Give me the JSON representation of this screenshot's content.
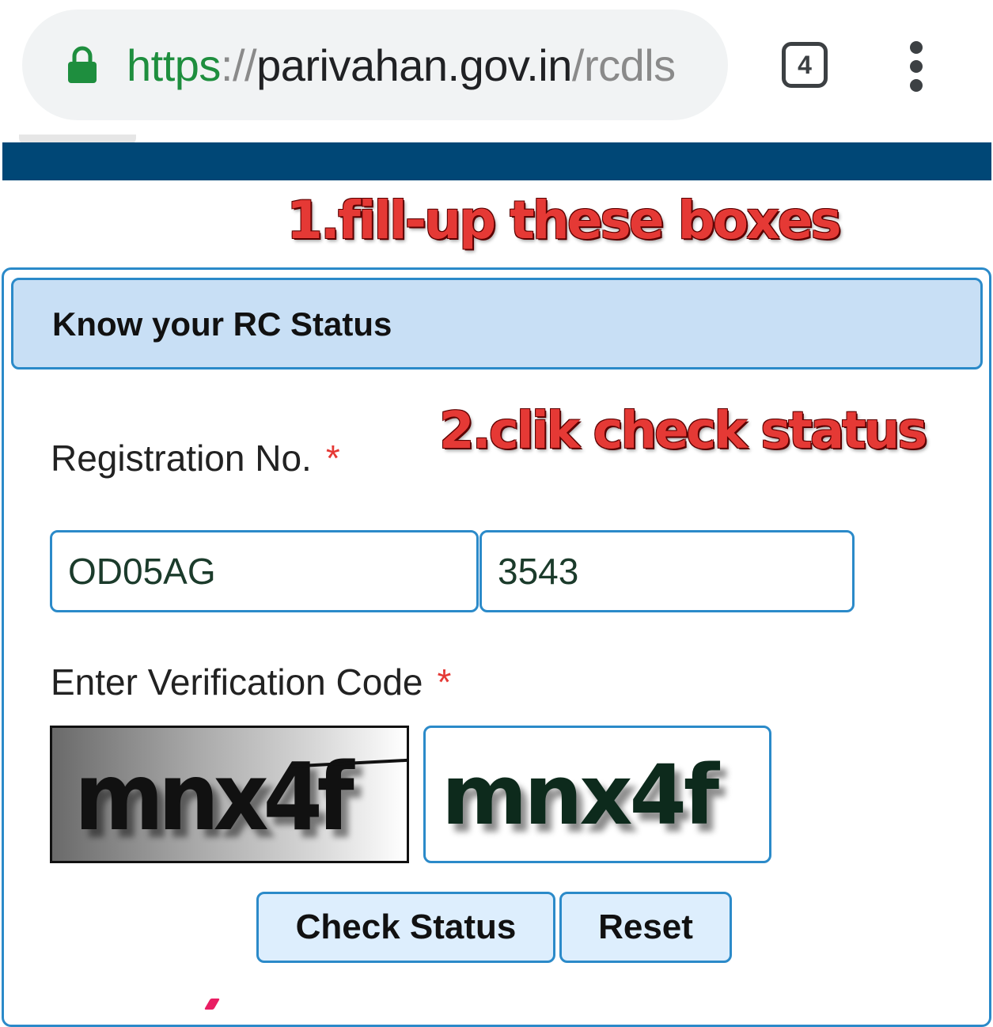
{
  "browser": {
    "url": {
      "scheme": "https",
      "separator": "://",
      "host": "parivahan.gov.in",
      "path": "/rcdls"
    },
    "tab_count": "4",
    "icons": {
      "lock": "lock-icon",
      "tabs": "tabs-icon",
      "menu": "more-vert-icon"
    }
  },
  "annotations": {
    "step1": "1.fill-up these boxes",
    "step2": "2.clik check status"
  },
  "form": {
    "title": "Know your RC Status",
    "registration_label": "Registration No.",
    "required_marker": "*",
    "registration_state_value": "OD05AG",
    "registration_number_value": "3543",
    "verification_label": "Enter Verification Code",
    "captcha_text": "mnx4f",
    "verification_value": "mnx4f",
    "check_button": "Check Status",
    "reset_button": "Reset"
  },
  "colors": {
    "header_bar": "#004776",
    "card_border": "#2b8ac9",
    "card_header_bg": "#c8dff5",
    "required": "#e53935",
    "annotation": "#e53935",
    "url_scheme": "#1e8e3e"
  }
}
